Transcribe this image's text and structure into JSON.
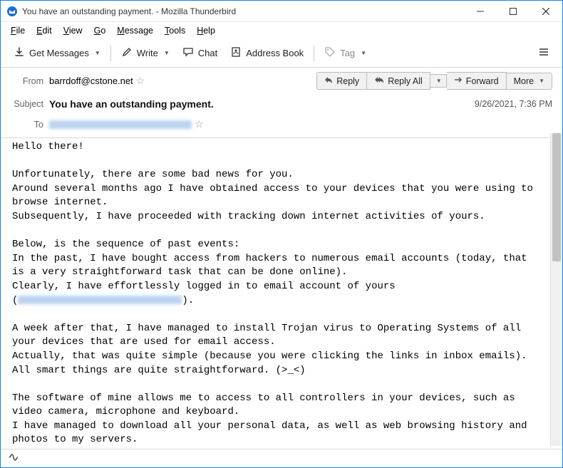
{
  "window": {
    "title": "You have an outstanding payment. - Mozilla Thunderbird"
  },
  "menu": {
    "file": "File",
    "edit": "Edit",
    "view": "View",
    "go": "Go",
    "message": "Message",
    "tools": "Tools",
    "help": "Help"
  },
  "toolbar": {
    "get_messages": "Get Messages",
    "write": "Write",
    "chat": "Chat",
    "address_book": "Address Book",
    "tag": "Tag"
  },
  "headers": {
    "from_label": "From",
    "from_value": "barrdoff@cstone.net",
    "subject_label": "Subject",
    "subject_value": "You have an outstanding payment.",
    "to_label": "To",
    "date": "9/26/2021, 7:36 PM"
  },
  "actions": {
    "reply": "Reply",
    "reply_all": "Reply All",
    "forward": "Forward",
    "more": "More"
  },
  "body": {
    "greeting": "Hello there!",
    "p1": "Unfortunately, there are some bad news for you.\nAround several months ago I have obtained access to your devices that you were using to browse internet.\nSubsequently, I have proceeded with tracking down internet activities of yours.",
    "p2a": "Below, is the sequence of past events:\nIn the past, I have bought access from hackers to numerous email accounts (today, that is a very straightforward task that can be done online).\nClearly, I have effortlessly logged in to email account of yours\n(",
    "p2b": ").",
    "p3": "A week after that, I have managed to install Trojan virus to Operating Systems of all your devices that are used for email access.\nActually, that was quite simple (because you were clicking the links in inbox emails).\nAll smart things are quite straightforward. (>_<)",
    "p4": "The software of mine allows me to access to all controllers in your devices, such as video camera, microphone and keyboard.\nI have managed to download all your personal data, as well as web browsing history and photos to my servers."
  }
}
